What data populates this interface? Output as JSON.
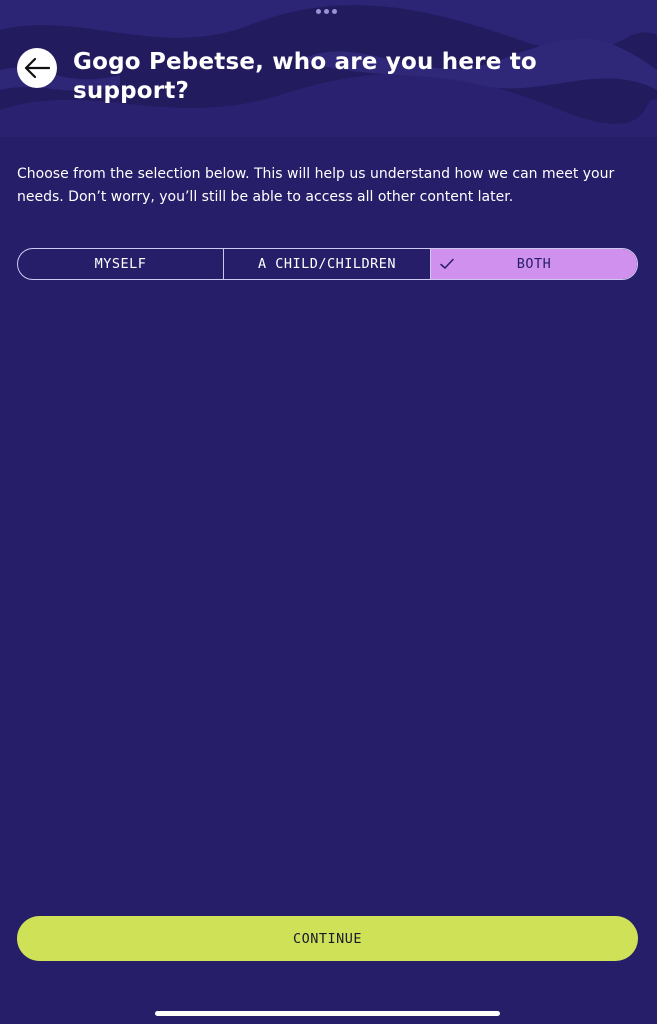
{
  "header": {
    "title": "Gogo Pebetse, who are you here to support?",
    "back_icon": "arrow-left-icon"
  },
  "description": "Choose from the selection below. This will help us understand how we can meet your needs. Don’t worry, you’ll still be able to access all other content later.",
  "options": [
    {
      "label": "MYSELF",
      "selected": false
    },
    {
      "label": "A CHILD/CHILDREN",
      "selected": false
    },
    {
      "label": "BOTH",
      "selected": true
    }
  ],
  "continue_label": "CONTINUE",
  "colors": {
    "background": "#261e69",
    "selected_segment": "#cf90ee",
    "continue_button": "#cfe257"
  }
}
